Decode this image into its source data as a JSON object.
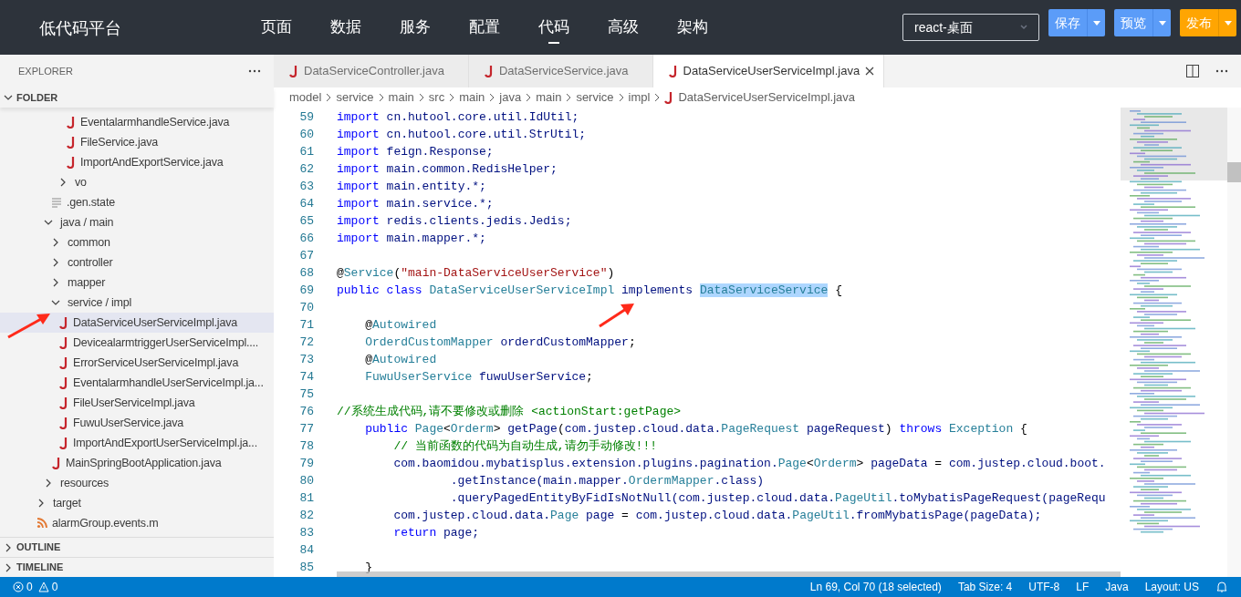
{
  "app": {
    "title": "低代码平台"
  },
  "nav": [
    {
      "label": "页面",
      "selected": false
    },
    {
      "label": "数据",
      "selected": false
    },
    {
      "label": "服务",
      "selected": false
    },
    {
      "label": "配置",
      "selected": false
    },
    {
      "label": "代码",
      "selected": true
    },
    {
      "label": "高级",
      "selected": false
    },
    {
      "label": "架构",
      "selected": false
    }
  ],
  "project_select": {
    "value": "react-桌面"
  },
  "actions": [
    {
      "label": "保存",
      "kind": "primary"
    },
    {
      "label": "预览",
      "kind": "primary"
    },
    {
      "label": "发布",
      "kind": "publish"
    }
  ],
  "sidebar": {
    "title": "EXPLORER",
    "folder": {
      "title": "FOLDER",
      "expanded": true,
      "tree": [
        {
          "children": [
            {
              "children": [
                {
                  "children": [
                    {
                      "children": [
                        {
                          "label": "EventalarmhandleService.java",
                          "kind": "java",
                          "selected": false
                        },
                        {
                          "label": "FileService.java",
                          "kind": "java",
                          "selected": false
                        },
                        {
                          "label": "ImportAndExportService.java",
                          "kind": "java",
                          "selected": false
                        }
                      ]
                    },
                    {
                      "label": "vo",
                      "kind": "folder",
                      "expanded": false
                    }
                  ]
                },
                {
                  "label": ".gen.state",
                  "kind": "text",
                  "selected": false
                }
              ]
            },
            {
              "label": "java / main",
              "kind": "folder",
              "expanded": true,
              "children": [
                {
                  "label": "common",
                  "kind": "folder",
                  "expanded": false
                },
                {
                  "label": "controller",
                  "kind": "folder",
                  "expanded": false
                },
                {
                  "label": "mapper",
                  "kind": "folder",
                  "expanded": false
                },
                {
                  "label": "service / impl",
                  "kind": "folder",
                  "expanded": true,
                  "children": [
                    {
                      "label": "DataServiceUserServiceImpl.java",
                      "kind": "java",
                      "selected": true
                    },
                    {
                      "label": "DevicealarmtriggerUserServiceImpl....",
                      "kind": "java",
                      "selected": false
                    },
                    {
                      "label": "ErrorServiceUserServiceImpl.java",
                      "kind": "java",
                      "selected": false
                    },
                    {
                      "label": "EventalarmhandleUserServiceImpl.ja...",
                      "kind": "java",
                      "selected": false
                    },
                    {
                      "label": "FileUserServiceImpl.java",
                      "kind": "java",
                      "selected": false
                    },
                    {
                      "label": "FuwuUserService.java",
                      "kind": "java",
                      "selected": false
                    },
                    {
                      "label": "ImportAndExportUserServiceImpl.ja...",
                      "kind": "java",
                      "selected": false
                    }
                  ]
                },
                {
                  "label": "MainSpringBootApplication.java",
                  "kind": "java",
                  "selected": false
                }
              ]
            },
            {
              "label": "resources",
              "kind": "folder",
              "expanded": false
            }
          ]
        },
        {
          "label": "target",
          "kind": "folder",
          "expanded": false
        },
        {
          "label": "alarmGroup.events.m",
          "kind": "feed",
          "selected": false
        }
      ]
    },
    "panels": [
      {
        "title": "OUTLINE",
        "expanded": false
      },
      {
        "title": "TIMELINE",
        "expanded": false
      }
    ]
  },
  "editor": {
    "tabs": [
      {
        "label": "DataServiceController.java",
        "selected": false
      },
      {
        "label": "DataServiceService.java",
        "selected": false
      },
      {
        "label": "DataServiceUserServiceImpl.java",
        "selected": true
      }
    ],
    "breadcrumb": [
      "model",
      "service",
      "main",
      "src",
      "main",
      "java",
      "main",
      "service",
      "impl",
      "DataServiceUserServiceImpl.java"
    ],
    "lines": [
      {
        "number": "59",
        "tokens": [
          {
            "kind": "keyword",
            "text": "import"
          },
          {
            "kind": "identifier",
            "text": " cn.hutool.core.util.IdUtil;"
          }
        ]
      },
      {
        "number": "60",
        "tokens": [
          {
            "kind": "keyword",
            "text": "import"
          },
          {
            "kind": "identifier",
            "text": " cn.hutool.core.util.StrUtil;"
          }
        ]
      },
      {
        "number": "61",
        "tokens": [
          {
            "kind": "keyword",
            "text": "import"
          },
          {
            "kind": "identifier",
            "text": " feign.Response;"
          }
        ]
      },
      {
        "number": "62",
        "tokens": [
          {
            "kind": "keyword",
            "text": "import"
          },
          {
            "kind": "identifier",
            "text": " main.common.RedisHelper;"
          }
        ]
      },
      {
        "number": "63",
        "tokens": [
          {
            "kind": "keyword",
            "text": "import"
          },
          {
            "kind": "identifier",
            "text": " main.entity.*;"
          }
        ]
      },
      {
        "number": "64",
        "tokens": [
          {
            "kind": "keyword",
            "text": "import"
          },
          {
            "kind": "identifier",
            "text": " main.service.*;"
          }
        ]
      },
      {
        "number": "65",
        "tokens": [
          {
            "kind": "keyword",
            "text": "import"
          },
          {
            "kind": "identifier",
            "text": " redis.clients.jedis.Jedis;"
          }
        ]
      },
      {
        "number": "66",
        "tokens": [
          {
            "kind": "keyword",
            "text": "import"
          },
          {
            "kind": "identifier",
            "text": " main.mapper.*;"
          }
        ]
      },
      {
        "number": "67"
      },
      {
        "number": "68",
        "tokens": [
          {
            "kind": "plain",
            "text": "@"
          },
          {
            "kind": "type",
            "text": "Service"
          },
          {
            "kind": "plain",
            "text": "("
          },
          {
            "kind": "string",
            "text": "\"main-DataServiceUserService\""
          },
          {
            "kind": "plain",
            "text": ")"
          }
        ]
      },
      {
        "number": "69",
        "tokens": [
          {
            "kind": "keyword",
            "text": "public class"
          },
          {
            "kind": "type",
            "text": " DataServiceUserServiceImpl"
          },
          {
            "kind": "identifier",
            "text": " implements "
          },
          {
            "kind": "selection",
            "text": "DataServiceService"
          },
          {
            "kind": "plain",
            "text": " {"
          }
        ]
      },
      {
        "number": "70"
      },
      {
        "number": "71",
        "tokens": [
          {
            "kind": "plain",
            "text": "    @"
          },
          {
            "kind": "type",
            "text": "Autowired"
          }
        ]
      },
      {
        "number": "72",
        "tokens": [
          {
            "kind": "type",
            "text": "    OrderdCustomMapper"
          },
          {
            "kind": "identifier",
            "text": " orderdCustomMapper"
          },
          {
            "kind": "plain",
            "text": ";"
          }
        ]
      },
      {
        "number": "73",
        "tokens": [
          {
            "kind": "plain",
            "text": "    @"
          },
          {
            "kind": "type",
            "text": "Autowired"
          }
        ]
      },
      {
        "number": "74",
        "tokens": [
          {
            "kind": "type",
            "text": "    FuwuUserService"
          },
          {
            "kind": "identifier",
            "text": " fuwuUserService"
          },
          {
            "kind": "plain",
            "text": ";"
          }
        ]
      },
      {
        "number": "75"
      },
      {
        "number": "76",
        "tokens": [
          {
            "kind": "comment",
            "text": "//系统生成代码,请不要修改或删除 <actionStart:getPage>"
          }
        ]
      },
      {
        "number": "77",
        "tokens": [
          {
            "kind": "keyword",
            "text": "    public"
          },
          {
            "kind": "type",
            "text": " Page"
          },
          {
            "kind": "plain",
            "text": "<"
          },
          {
            "kind": "type",
            "text": "Orderm"
          },
          {
            "kind": "plain",
            "text": "> "
          },
          {
            "kind": "identifier",
            "text": "getPage"
          },
          {
            "kind": "plain",
            "text": "("
          },
          {
            "kind": "identifier",
            "text": "com.justep.cloud.data."
          },
          {
            "kind": "type",
            "text": "PageRequest"
          },
          {
            "kind": "identifier",
            "text": " pageRequest"
          },
          {
            "kind": "plain",
            "text": ") "
          },
          {
            "kind": "keyword",
            "text": "throws"
          },
          {
            "kind": "type",
            "text": " Exception"
          },
          {
            "kind": "plain",
            "text": " {"
          }
        ]
      },
      {
        "number": "78",
        "tokens": [
          {
            "kind": "comment",
            "text": "        // 当前函数的代码为自动生成,请勿手动修改!!!"
          }
        ]
      },
      {
        "number": "79",
        "tokens": [
          {
            "kind": "identifier",
            "text": "        com.baomidou.mybatisplus.extension.plugins.pagination."
          },
          {
            "kind": "type",
            "text": "Page"
          },
          {
            "kind": "plain",
            "text": "<"
          },
          {
            "kind": "type",
            "text": "Orderm"
          },
          {
            "kind": "plain",
            "text": ">"
          },
          {
            "kind": "identifier",
            "text": " pageData"
          },
          {
            "kind": "plain",
            "text": " = "
          },
          {
            "kind": "identifier",
            "text": "com.justep.cloud.boot."
          }
        ]
      },
      {
        "number": "80",
        "tokens": [
          {
            "kind": "identifier",
            "text": "                .getInstance(main.mapper."
          },
          {
            "kind": "type",
            "text": "OrdermMapper"
          },
          {
            "kind": "identifier",
            "text": ".class)"
          }
        ]
      },
      {
        "number": "81",
        "tokens": [
          {
            "kind": "identifier",
            "text": "                .queryPagedEntityByFidIsNotNull(com.justep.cloud.data."
          },
          {
            "kind": "type",
            "text": "PageUtil"
          },
          {
            "kind": "identifier",
            "text": ".toMybatisPageRequest(pageRequ"
          }
        ]
      },
      {
        "number": "82",
        "tokens": [
          {
            "kind": "identifier",
            "text": "        com.justep.cloud.data."
          },
          {
            "kind": "type",
            "text": "Page"
          },
          {
            "kind": "identifier",
            "text": " page"
          },
          {
            "kind": "plain",
            "text": " = "
          },
          {
            "kind": "identifier",
            "text": "com.justep.cloud.data."
          },
          {
            "kind": "type",
            "text": "PageUtil"
          },
          {
            "kind": "identifier",
            "text": ".fromMybatisPage(pageData);"
          }
        ]
      },
      {
        "number": "83",
        "tokens": [
          {
            "kind": "keyword",
            "text": "        return"
          },
          {
            "kind": "identifier",
            "text": " page;"
          }
        ]
      },
      {
        "number": "84"
      },
      {
        "number": "85",
        "tokens": [
          {
            "kind": "plain",
            "text": "    }"
          }
        ]
      }
    ]
  },
  "status_bar": {
    "errors": "0",
    "warnings": "0",
    "items": [
      "Ln 69, Col 70 (18 selected)",
      "Tab Size: 4",
      "UTF-8",
      "LF",
      "Java",
      "Layout: US"
    ]
  }
}
